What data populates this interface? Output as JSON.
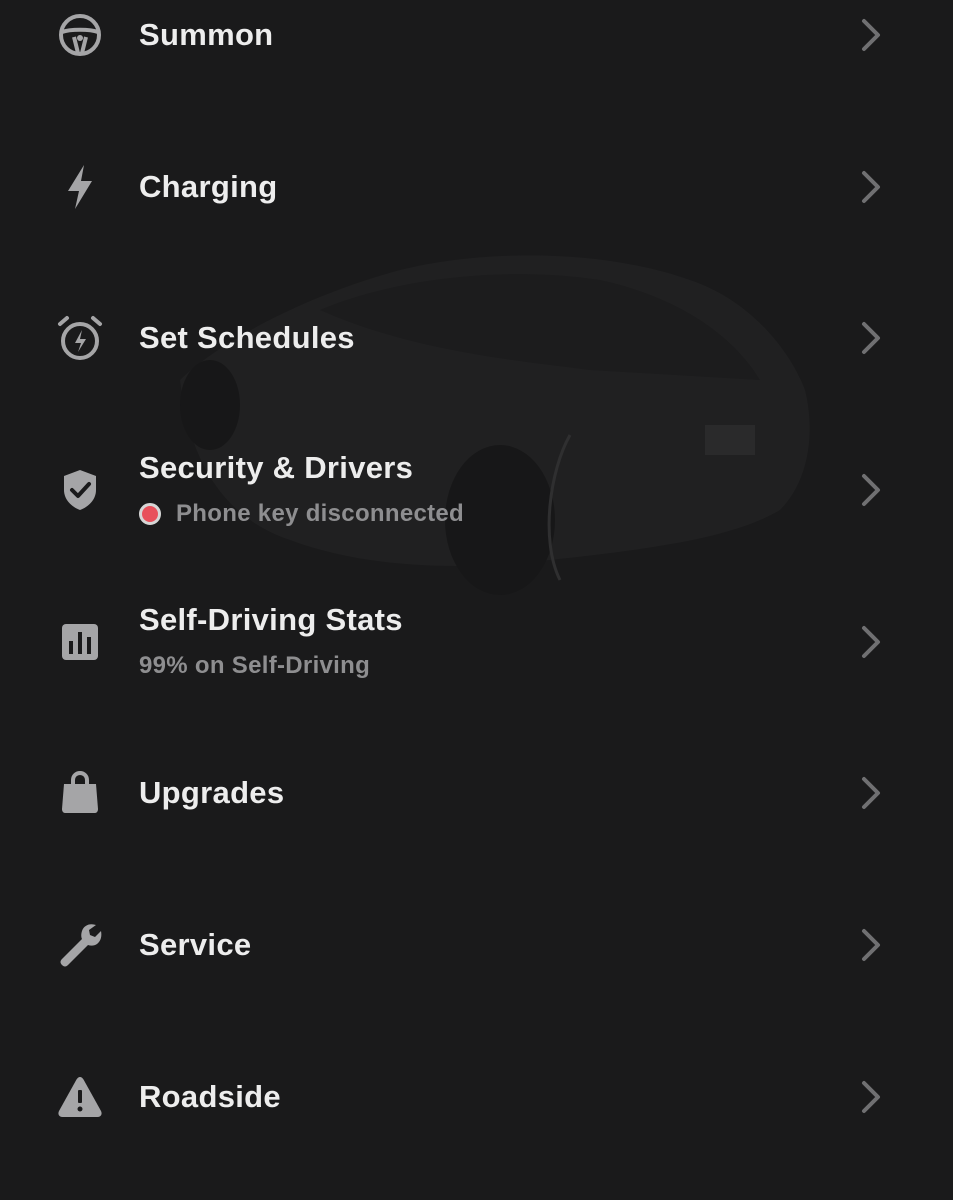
{
  "menu": {
    "items": [
      {
        "label": "Summon",
        "icon": "steering-wheel-icon"
      },
      {
        "label": "Charging",
        "icon": "lightning-bolt-icon"
      },
      {
        "label": "Set Schedules",
        "icon": "alarm-clock-bolt-icon"
      },
      {
        "label": "Security & Drivers",
        "icon": "shield-check-icon",
        "status": "Phone key disconnected",
        "status_color": "#e8505b"
      },
      {
        "label": "Self-Driving Stats",
        "icon": "bar-chart-icon",
        "subtitle": "99% on Self-Driving"
      },
      {
        "label": "Upgrades",
        "icon": "shopping-bag-icon"
      },
      {
        "label": "Service",
        "icon": "wrench-icon"
      },
      {
        "label": "Roadside",
        "icon": "warning-triangle-icon"
      }
    ],
    "chevron_icon": "chevron-right-icon"
  },
  "theme": {
    "background": "#1a1a1b",
    "text": "#ededed",
    "subtext": "#8e8e90",
    "icon": "#a5a5a7",
    "chevron": "#707072"
  }
}
